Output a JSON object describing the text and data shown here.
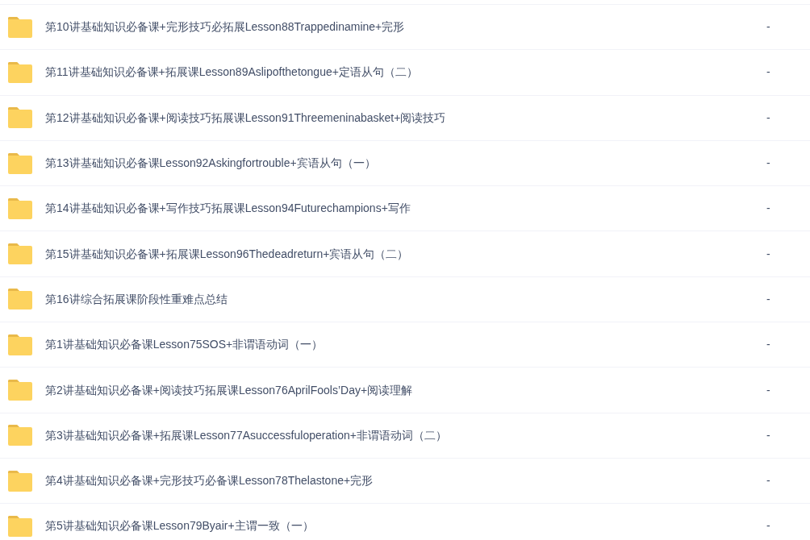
{
  "files": [
    {
      "name": "第10讲基础知识必备课+完形技巧必拓展Lesson88Trappedinamine+完形",
      "size": "-"
    },
    {
      "name": "第11讲基础知识必备课+拓展课Lesson89Aslipofthetongue+定语从句（二）",
      "size": "-"
    },
    {
      "name": "第12讲基础知识必备课+阅读技巧拓展课Lesson91Threemeninabasket+阅读技巧",
      "size": "-"
    },
    {
      "name": "第13讲基础知识必备课Lesson92Askingfortrouble+宾语从句（一）",
      "size": "-"
    },
    {
      "name": "第14讲基础知识必备课+写作技巧拓展课Lesson94Futurechampions+写作",
      "size": "-"
    },
    {
      "name": "第15讲基础知识必备课+拓展课Lesson96Thedeadreturn+宾语从句（二）",
      "size": "-"
    },
    {
      "name": "第16讲综合拓展课阶段性重难点总结",
      "size": "-"
    },
    {
      "name": "第1讲基础知识必备课Lesson75SOS+非谓语动词（一）",
      "size": "-"
    },
    {
      "name": "第2讲基础知识必备课+阅读技巧拓展课Lesson76AprilFools’Day+阅读理解",
      "size": "-"
    },
    {
      "name": "第3讲基础知识必备课+拓展课Lesson77Asuccessfuloperation+非谓语动词（二）",
      "size": "-"
    },
    {
      "name": "第4讲基础知识必备课+完形技巧必备课Lesson78Thelastone+完形",
      "size": "-"
    },
    {
      "name": "第5讲基础知识必备课Lesson79Byair+主谓一致（一）",
      "size": "-"
    }
  ]
}
